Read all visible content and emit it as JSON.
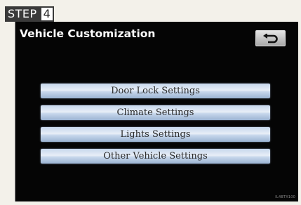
{
  "step": {
    "word": "STEP",
    "number": "4"
  },
  "screen": {
    "title": "Vehicle Customization",
    "back_icon": "return-arrow-icon",
    "menu": [
      {
        "label": "Door Lock Settings"
      },
      {
        "label": "Climate Settings"
      },
      {
        "label": "Lights Settings"
      },
      {
        "label": "Other Vehicle Settings"
      }
    ]
  },
  "figure_code": "IL4BTX100",
  "colors": {
    "screen_background": "#050505",
    "button_blue_light": "#e8eef7",
    "button_blue_dark": "#9bb3d2",
    "step_label_dark": "#3a3a3a"
  }
}
